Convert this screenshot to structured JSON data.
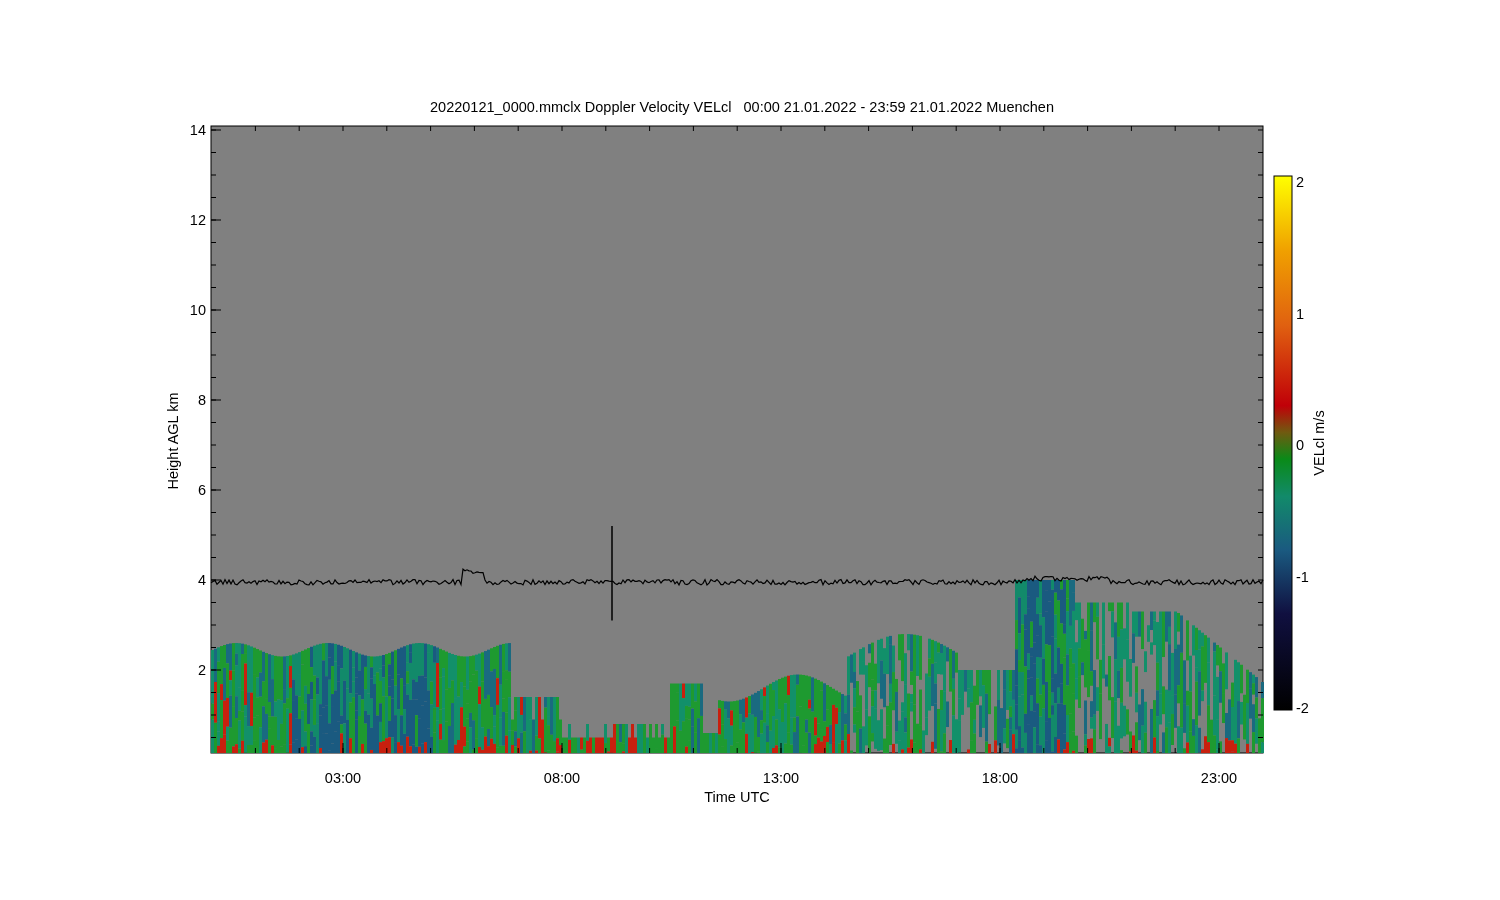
{
  "title": "20220121_0000.mmclx Doppler Velocity VELcl   00:00 21.01.2022 - 23:59 21.01.2022 Muenchen",
  "y_axis": {
    "label": "Height AGL km",
    "ticks": [
      "14",
      "12",
      "10",
      "8",
      "6",
      "4",
      "2"
    ]
  },
  "x_axis": {
    "label": "Time UTC",
    "ticks": [
      "03:00",
      "08:00",
      "13:00",
      "18:00",
      "23:00"
    ]
  },
  "colorbar": {
    "label": "VELcl m/s",
    "ticks": [
      "2",
      "1",
      "0",
      "-1",
      "-2"
    ]
  }
}
